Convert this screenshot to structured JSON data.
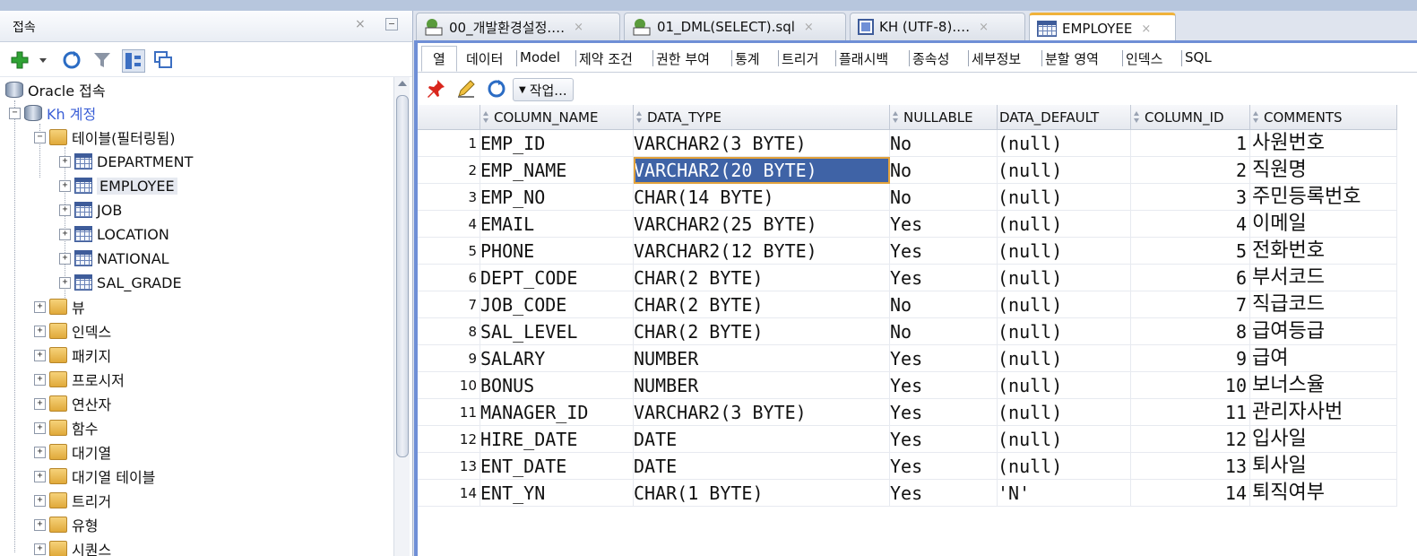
{
  "colors": {
    "accent": "#6f8fd6",
    "active_tab_top": "#f0b23b",
    "selection": "#3f63a6",
    "link": "#3b5fd6"
  },
  "left_panel": {
    "title": "접속",
    "close_glyph": "×",
    "tree": {
      "root": "Oracle 접속",
      "connection": "Kh 계정",
      "tables_folder": "테이블(필터링됨)",
      "tables": [
        "DEPARTMENT",
        "EMPLOYEE",
        "JOB",
        "LOCATION",
        "NATIONAL",
        "SAL_GRADE"
      ],
      "folders": [
        "뷰",
        "인덱스",
        "패키지",
        "프로시저",
        "연산자",
        "함수",
        "대기열",
        "대기열 테이블",
        "트리거",
        "유형",
        "시퀀스"
      ]
    }
  },
  "editor_tabs": [
    {
      "label": "00_개발환경설정.…",
      "icon": "sql-icon"
    },
    {
      "label": "01_DML(SELECT).sql",
      "icon": "sql-icon"
    },
    {
      "label": "KH (UTF-8).…",
      "icon": "worksheet-icon"
    },
    {
      "label": "EMPLOYEE",
      "icon": "table-icon"
    }
  ],
  "subtabs": [
    "열",
    "데이터",
    "Model",
    "제약 조건",
    "권한 부여",
    "통계",
    "트리거",
    "플래시백",
    "종속성",
    "세부정보",
    "분할 영역",
    "인덱스",
    "SQL"
  ],
  "actions_label": "작업...",
  "grid": {
    "headers": [
      "COLUMN_NAME",
      "DATA_TYPE",
      "NULLABLE",
      "DATA_DEFAULT",
      "COLUMN_ID",
      "COMMENTS"
    ],
    "rows": [
      [
        "1",
        "EMP_ID",
        "VARCHAR2(3 BYTE)",
        "No",
        "(null)",
        "1",
        "사원번호"
      ],
      [
        "2",
        "EMP_NAME",
        "VARCHAR2(20 BYTE)",
        "No",
        "(null)",
        "2",
        "직원명"
      ],
      [
        "3",
        "EMP_NO",
        "CHAR(14 BYTE)",
        "No",
        "(null)",
        "3",
        "주민등록번호"
      ],
      [
        "4",
        "EMAIL",
        "VARCHAR2(25 BYTE)",
        "Yes",
        "(null)",
        "4",
        "이메일"
      ],
      [
        "5",
        "PHONE",
        "VARCHAR2(12 BYTE)",
        "Yes",
        "(null)",
        "5",
        "전화번호"
      ],
      [
        "6",
        "DEPT_CODE",
        "CHAR(2 BYTE)",
        "Yes",
        "(null)",
        "6",
        "부서코드"
      ],
      [
        "7",
        "JOB_CODE",
        "CHAR(2 BYTE)",
        "No",
        "(null)",
        "7",
        "직급코드"
      ],
      [
        "8",
        "SAL_LEVEL",
        "CHAR(2 BYTE)",
        "No",
        "(null)",
        "8",
        "급여등급"
      ],
      [
        "9",
        "SALARY",
        "NUMBER",
        "Yes",
        "(null)",
        "9",
        "급여"
      ],
      [
        "10",
        "BONUS",
        "NUMBER",
        "Yes",
        "(null)",
        "10",
        "보너스율"
      ],
      [
        "11",
        "MANAGER_ID",
        "VARCHAR2(3 BYTE)",
        "Yes",
        "(null)",
        "11",
        "관리자사번"
      ],
      [
        "12",
        "HIRE_DATE",
        "DATE",
        "Yes",
        "(null)",
        "12",
        "입사일"
      ],
      [
        "13",
        "ENT_DATE",
        "DATE",
        "Yes",
        "(null)",
        "13",
        "퇴사일"
      ],
      [
        "14",
        "ENT_YN",
        "CHAR(1 BYTE)",
        "Yes",
        "'N'",
        "14",
        "퇴직여부"
      ]
    ]
  }
}
